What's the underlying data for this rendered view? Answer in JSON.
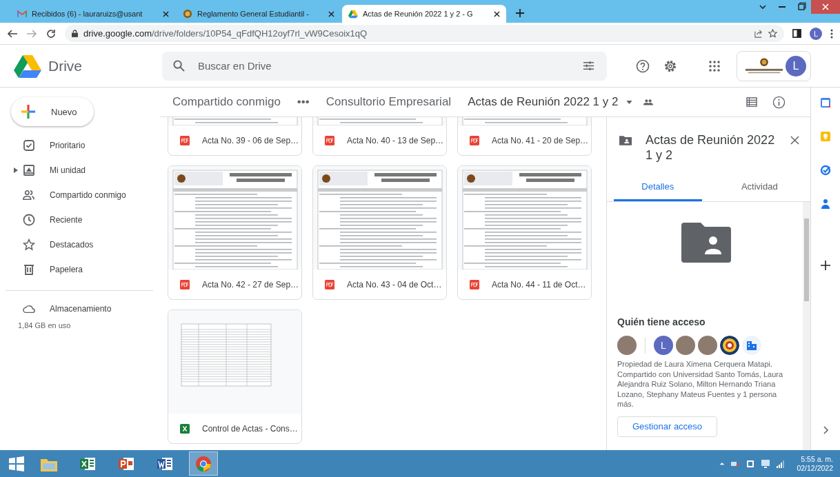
{
  "browser": {
    "tabs": [
      {
        "title": "Recibidos (6) - lauraruizs@usant",
        "kind": "mail",
        "selected": false
      },
      {
        "title": "Reglamento General Estudiantil -",
        "kind": "seal",
        "selected": false
      },
      {
        "title": "Actas de Reunión 2022 1 y 2 - G",
        "kind": "drive",
        "selected": true
      }
    ],
    "url_host": "drive.google.com",
    "url_path": "/drive/folders/10P54_qFdfQH12oyf7rl_vW9Cesoix1qQ",
    "avatar": "L"
  },
  "header": {
    "app_name": "Drive",
    "search_placeholder": "Buscar en Drive",
    "avatar": "L"
  },
  "sidebar": {
    "new_button": "Nuevo",
    "items": [
      {
        "label": "Prioritario",
        "expandable": false
      },
      {
        "label": "Mi unidad",
        "expandable": true
      },
      {
        "label": "Compartido conmigo",
        "expandable": false
      },
      {
        "label": "Reciente",
        "expandable": false
      },
      {
        "label": "Destacados",
        "expandable": false
      },
      {
        "label": "Papelera",
        "expandable": false
      }
    ],
    "storage_label": "Almacenamiento",
    "storage_usage": "1,84 GB en uso"
  },
  "breadcrumb": [
    "Compartido conmigo",
    "•••",
    "Consultorio Empresarial",
    "Actas de Reunión 2022 1 y 2"
  ],
  "files": [
    {
      "name": "Acta No. 39 - 06 de Sep…",
      "kind": "pdf"
    },
    {
      "name": "Acta No. 40 - 13 de Sep…",
      "kind": "pdf"
    },
    {
      "name": "Acta No. 41 - 20 de Sep…",
      "kind": "pdf"
    },
    {
      "name": "Acta No. 42 - 27 de Sep…",
      "kind": "pdf"
    },
    {
      "name": "Acta No. 43 - 04 de Oct…",
      "kind": "pdf"
    },
    {
      "name": "Acta No. 44 - 11 de Oct…",
      "kind": "pdf"
    },
    {
      "name": "Control de Actas - Cons…",
      "kind": "sheet"
    }
  ],
  "details": {
    "title": "Actas de Reunión 2022 1 y 2",
    "tabs": [
      {
        "label": "Detalles",
        "selected": true
      },
      {
        "label": "Actividad",
        "selected": false
      }
    ],
    "access_heading": "Quién tiene acceso",
    "access": [
      {
        "kind": "photo"
      },
      {
        "kind": "initial",
        "text": "L"
      },
      {
        "kind": "photo"
      },
      {
        "kind": "photo"
      },
      {
        "kind": "logo"
      },
      {
        "kind": "domain"
      }
    ],
    "sharing_text": "Propiedad de Laura Ximena Cerquera Matapi. Compartido con Universidad Santo Tomás, Laura Alejandra Ruiz Solano, Milton Hernando Triana Lozano, Stephany Mateus Fuentes y 1 persona más.",
    "manage_button": "Gestionar acceso"
  },
  "taskbar": {
    "apps": [
      {
        "kind": "explorer",
        "selected": false
      },
      {
        "kind": "excel",
        "selected": false
      },
      {
        "kind": "powerpoint",
        "selected": false
      },
      {
        "kind": "word",
        "selected": false
      },
      {
        "kind": "chrome",
        "selected": true
      }
    ],
    "time": "5:55 a. m.",
    "date": "02/12/2022"
  }
}
